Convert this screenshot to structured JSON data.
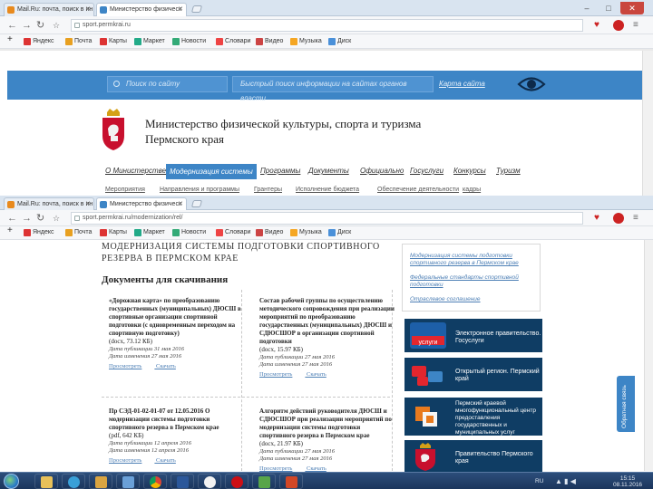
{
  "window1": {
    "tabs": [
      {
        "label": "Mail.Ru: почта, поиск в ин",
        "color": "#e88a1e"
      },
      {
        "label": "Министерство физическ",
        "color": "#3d85c6"
      }
    ],
    "address": "sport.permkrai.ru",
    "bookmarks": [
      {
        "label": "Яндекс",
        "color": "#d33"
      },
      {
        "label": "Почта",
        "color": "#e8a020"
      },
      {
        "label": "Карты",
        "color": "#d33"
      },
      {
        "label": "Маркет",
        "color": "#2a8"
      },
      {
        "label": "Новости",
        "color": "#3a7"
      },
      {
        "label": "Словари",
        "color": "#e44"
      },
      {
        "label": "Видео",
        "color": "#c44"
      },
      {
        "label": "Музыка",
        "color": "#f5a623"
      },
      {
        "label": "Диск",
        "color": "#4a90d9"
      }
    ],
    "search_site_placeholder": "Поиск по сайту",
    "search_other_placeholder": "Быстрый поиск информации на сайтах органов власти",
    "map_link": "Карта сайта",
    "ministry_title_line1": "Министерство физической культуры, спорта и туризма",
    "ministry_title_line2": "Пермского края",
    "menu": [
      "О Министерстве",
      "Модернизация системы",
      "Программы",
      "Документы",
      "Официально",
      "Госуслуги",
      "Конкурсы",
      "Туризм"
    ],
    "submenu": [
      "Мероприятия",
      "Направления и программы",
      "Грантеры",
      "Исполнение бюджета",
      "Обеспечение деятельности",
      "кадры"
    ]
  },
  "window2": {
    "tabs": [
      {
        "label": "Mail.Ru: почта, поиск в ин",
        "color": "#e88a1e"
      },
      {
        "label": "Министерство физическ",
        "color": "#3d85c6"
      }
    ],
    "address": "sport.permkrai.ru/modernization/rel/",
    "bookmarks": [
      {
        "label": "Яндекс",
        "color": "#d33"
      },
      {
        "label": "Почта",
        "color": "#e8a020"
      },
      {
        "label": "Карты",
        "color": "#d33"
      },
      {
        "label": "Маркет",
        "color": "#2a8"
      },
      {
        "label": "Новости",
        "color": "#3a7"
      },
      {
        "label": "Словари",
        "color": "#e44"
      },
      {
        "label": "Видео",
        "color": "#c44"
      },
      {
        "label": "Музыка",
        "color": "#f5a623"
      },
      {
        "label": "Диск",
        "color": "#4a90d9"
      }
    ],
    "page_title_line1": "МОДЕРНИЗАЦИЯ СИСТЕМЫ ПОДГОТОВКИ СПОРТИВНОГО",
    "page_title_line2": "РЕЗЕРВА В ПЕРМСКОМ КРАЕ",
    "documents_title": "Документы для скачивания",
    "docs": [
      {
        "title": "«Дорожная карта» по преобразованию государственных (муниципальных) ДЮСШ в спортивные организации спортивной подготовки (с одновременным переходом на спортивную подготовку)",
        "file": "(docx, 73.12 КБ)",
        "published": "Дата публикации 31 мая 2016",
        "changed": "Дата изменения 27 мая 2016",
        "view": "Просмотреть",
        "download": "Скачать"
      },
      {
        "title": "Состав рабочей группы по осуществлению методического сопровождения при реализации мероприятий по преобразованию государственных (муниципальных) ДЮСШ и СДЮСШОР в организации спортивной подготовки",
        "file": "(docx, 15.97 КБ)",
        "published": "Дата публикации 27 мая 2016",
        "changed": "Дата изменения 27 мая 2016",
        "view": "Просмотреть",
        "download": "Скачать"
      },
      {
        "title": "Пр СЭД-01-02-01-07 от 12.05.2016 О модернизации системы подготовки спортивного резерва в Пермском крае",
        "file": "(pdf, 642 КБ)",
        "published": "Дата публикации 12 апреля 2016",
        "changed": "Дата изменения 12 апреля 2016",
        "view": "Просмотреть",
        "download": "Скачать"
      },
      {
        "title": "Алгоритм действий руководителя ДЮСШ и СДЮСШОР при реализации мероприятий по модернизации системы подготовки спортивного резерва в Пермском крае",
        "file": "(docx, 21.97 КБ)",
        "published": "Дата публикации 27 мая 2016",
        "changed": "Дата изменения 27 мая 2016",
        "view": "Просмотреть",
        "download": "Скачать"
      }
    ],
    "side_links": [
      "Модернизация системы подготовки спортивного резерва в Пермском крае",
      "Федеральные стандарты спортивной подготовки",
      "Отраслевое соглашение"
    ],
    "banners": [
      {
        "text": "Электронное правительство. Госуслуги",
        "badge": "услуги"
      },
      {
        "text": "Открытый регион. Пермский край",
        "badge": ""
      },
      {
        "text": "Пермский краевой многофункциональный центр предоставления государственных и муниципальных услуг",
        "badge": ""
      },
      {
        "text": "Правительство Пермского края",
        "badge": ""
      }
    ],
    "side_tab": "Обратная связь"
  },
  "taskbar": {
    "lang": "RU",
    "time": "15:15",
    "date": "08.11.2016"
  }
}
